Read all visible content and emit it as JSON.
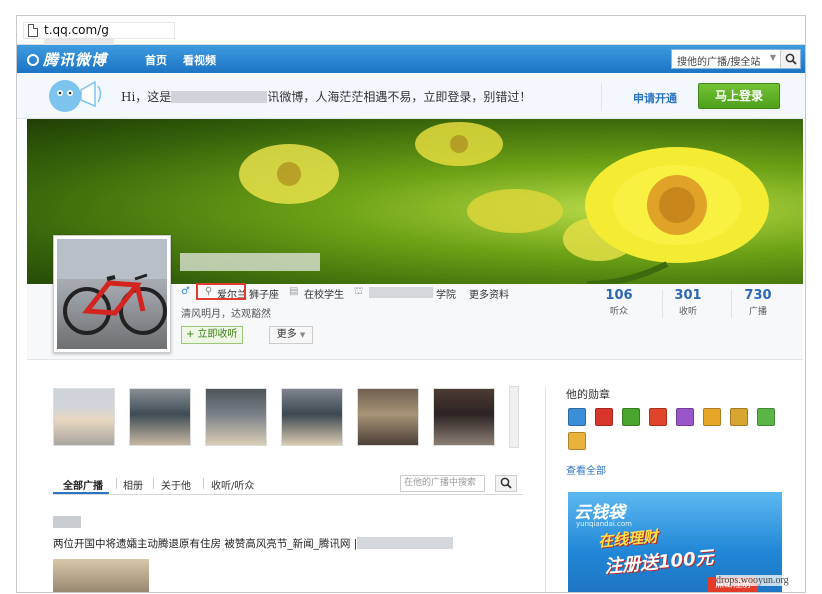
{
  "browser": {
    "url": "t.qq.com/g"
  },
  "nav": {
    "logo": "腾讯微博",
    "links": [
      "首页",
      "看视频"
    ],
    "search_placeholder": "搜他的广播/搜全站"
  },
  "loginbar": {
    "message_prefix": "Hi，这是",
    "message_suffix": "讯微博，人海茫茫相遇不易，立即登录，别错过！",
    "apply_label": "申请开通",
    "login_label": "马上登录"
  },
  "profile": {
    "location": "爱尔兰",
    "zodiac": "狮子座",
    "status": "在校学生",
    "school_suffix": "学院",
    "more_info": "更多资料",
    "motto": "清风明月，达观豁然",
    "follow_label": "+ 立即收听",
    "more_label": "更多",
    "stats": [
      {
        "value": "106",
        "label": "听众"
      },
      {
        "value": "301",
        "label": "收听"
      },
      {
        "value": "730",
        "label": "广播"
      }
    ]
  },
  "tabs": [
    "全部广播",
    "相册",
    "关于他",
    "收听/听众"
  ],
  "feed": {
    "search_placeholder": "在他的广播中搜索",
    "post_text": "两位开国中将遗孀主动腾退原有住房 被赞高风亮节_新闻_腾讯网 |"
  },
  "sidebar": {
    "badges_title": "他的勋章",
    "see_all": "查看全部",
    "badge_colors": [
      "#3a8fd8",
      "#d8352a",
      "#4aa52e",
      "#e0452b",
      "#9a55c9",
      "#e8a628",
      "#d9a531",
      "#5ab546",
      "#e9b23a"
    ]
  },
  "ad": {
    "brand": "云钱袋",
    "site": "yunqiandai.com",
    "line1": "在线理财",
    "line2": "注册送100元",
    "cta": "点击注册"
  },
  "watermark": "drops.wooyun.org"
}
